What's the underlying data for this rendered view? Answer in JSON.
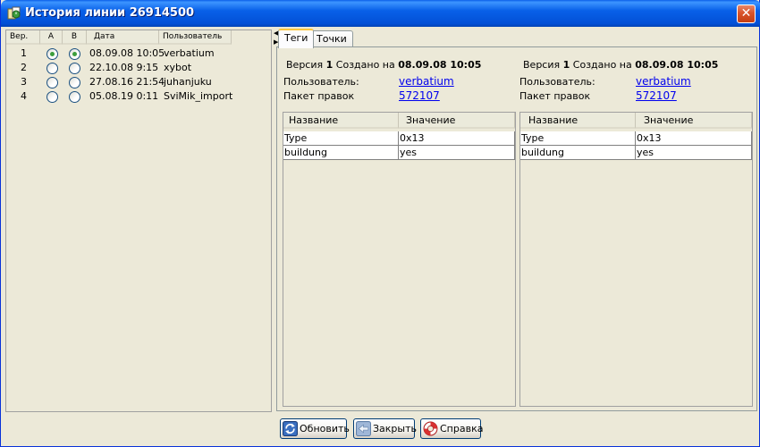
{
  "window": {
    "title": "История линии 26914500",
    "close_glyph": "✕"
  },
  "history": {
    "columns": {
      "ver": "Вер.",
      "a": "A",
      "b": "B",
      "date": "Дата",
      "user": "Пользователь"
    },
    "rows": [
      {
        "ver": "1",
        "date": "08.09.08 10:05",
        "user": "verbatium",
        "a_checked": true,
        "b_checked": true
      },
      {
        "ver": "2",
        "date": "22.10.08 9:15",
        "user": "xybot",
        "a_checked": false,
        "b_checked": false
      },
      {
        "ver": "3",
        "date": "27.08.16 21:54",
        "user": "juhanjuku",
        "a_checked": false,
        "b_checked": false
      },
      {
        "ver": "4",
        "date": "05.08.19 0:11",
        "user": "SviMik_import",
        "a_checked": false,
        "b_checked": false
      }
    ]
  },
  "tabs": {
    "tags": "Теги",
    "points": "Точки",
    "active": "tags"
  },
  "compare": {
    "left": {
      "version_prefix": "Версия",
      "version_num": "1",
      "created_label": "Создано на",
      "created_at": "08.09.08 10:05",
      "user_label": "Пользователь:",
      "user": "verbatium",
      "changeset_label": "Пакет правок",
      "changeset": "572107",
      "columns": {
        "name": "Название",
        "value": "Значение"
      },
      "tags": [
        {
          "key": "Type",
          "value": "0x13"
        },
        {
          "key": "buildung",
          "value": "yes"
        }
      ]
    },
    "right": {
      "version_prefix": "Версия",
      "version_num": "1",
      "created_label": "Создано на",
      "created_at": "08.09.08 10:05",
      "user_label": "Пользователь:",
      "user": "verbatium",
      "changeset_label": "Пакет правок",
      "changeset": "572107",
      "columns": {
        "name": "Название",
        "value": "Значение"
      },
      "tags": [
        {
          "key": "Type",
          "value": "0x13"
        },
        {
          "key": "buildung",
          "value": "yes"
        }
      ]
    }
  },
  "buttons": {
    "refresh": "Обновить",
    "close": "Закрыть",
    "help": "Справка"
  },
  "icons": {
    "title": "history-icon",
    "refresh": "refresh-icon",
    "close": "close-arrow-icon",
    "help": "lifebuoy-icon"
  }
}
